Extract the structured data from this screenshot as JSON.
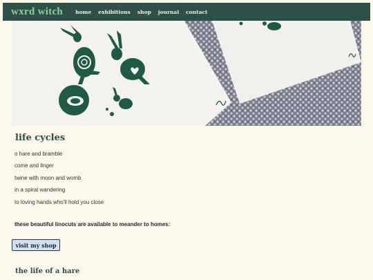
{
  "site": {
    "brand": "wxrd witch"
  },
  "nav": {
    "items": [
      "home",
      "exhibitions",
      "shop",
      "journal",
      "contact"
    ]
  },
  "hero": {
    "alt_subject": "linocut-hares-prints"
  },
  "section": {
    "title": "life cycles",
    "lines": [
      "o hare and bramble",
      "come and linger",
      "twine with moon and womb",
      "in a spiral wandering",
      "to loving hands who'll hold you close"
    ],
    "note": "these beautiful linocuts are available to meander to homes:",
    "button": "visit my shop",
    "subtitle": "the life of a hare"
  },
  "colors": {
    "nav_bg": "#2e5048",
    "brand": "#8fd19b",
    "page_bg": "#fdf8ec",
    "heading": "#2e4e45",
    "button_bg": "#cfe2f3",
    "ink": "#1f5a45"
  }
}
